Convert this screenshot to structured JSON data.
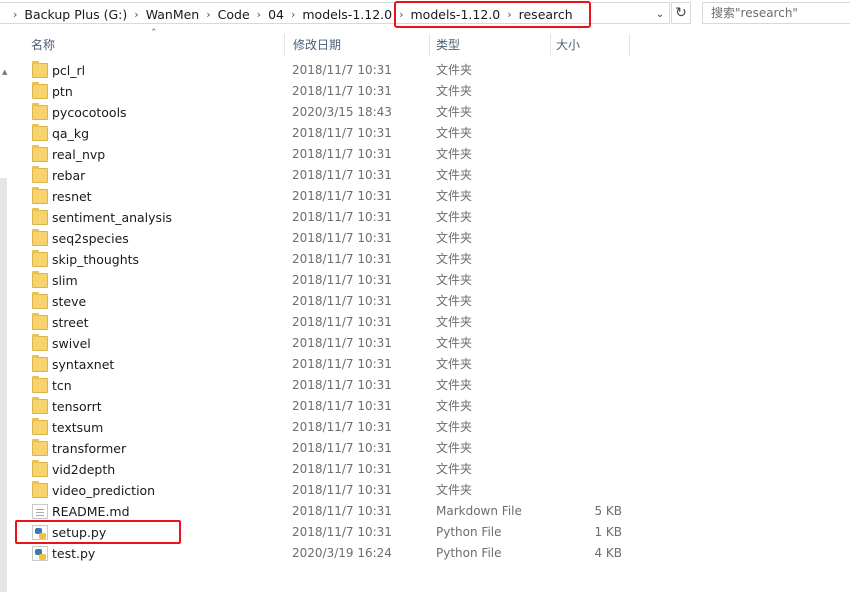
{
  "address": {
    "crumbs": [
      "Backup Plus (G:)",
      "WanMen",
      "Code",
      "04",
      "models-1.12.0"
    ],
    "highlighted_crumbs": [
      "models-1.12.0",
      "research"
    ],
    "search_placeholder": "搜索\"research\""
  },
  "columns": {
    "name": "名称",
    "date": "修改日期",
    "type": "类型",
    "size": "大小"
  },
  "files": [
    {
      "name": "pcl_rl",
      "date": "2018/11/7 10:31",
      "type": "文件夹",
      "size": "",
      "icon": "folder-icon"
    },
    {
      "name": "ptn",
      "date": "2018/11/7 10:31",
      "type": "文件夹",
      "size": "",
      "icon": "folder-icon"
    },
    {
      "name": "pycocotools",
      "date": "2020/3/15 18:43",
      "type": "文件夹",
      "size": "",
      "icon": "folder-icon"
    },
    {
      "name": "qa_kg",
      "date": "2018/11/7 10:31",
      "type": "文件夹",
      "size": "",
      "icon": "folder-icon"
    },
    {
      "name": "real_nvp",
      "date": "2018/11/7 10:31",
      "type": "文件夹",
      "size": "",
      "icon": "folder-icon"
    },
    {
      "name": "rebar",
      "date": "2018/11/7 10:31",
      "type": "文件夹",
      "size": "",
      "icon": "folder-icon"
    },
    {
      "name": "resnet",
      "date": "2018/11/7 10:31",
      "type": "文件夹",
      "size": "",
      "icon": "folder-icon"
    },
    {
      "name": "sentiment_analysis",
      "date": "2018/11/7 10:31",
      "type": "文件夹",
      "size": "",
      "icon": "folder-icon"
    },
    {
      "name": "seq2species",
      "date": "2018/11/7 10:31",
      "type": "文件夹",
      "size": "",
      "icon": "folder-icon"
    },
    {
      "name": "skip_thoughts",
      "date": "2018/11/7 10:31",
      "type": "文件夹",
      "size": "",
      "icon": "folder-icon"
    },
    {
      "name": "slim",
      "date": "2018/11/7 10:31",
      "type": "文件夹",
      "size": "",
      "icon": "folder-icon"
    },
    {
      "name": "steve",
      "date": "2018/11/7 10:31",
      "type": "文件夹",
      "size": "",
      "icon": "folder-icon"
    },
    {
      "name": "street",
      "date": "2018/11/7 10:31",
      "type": "文件夹",
      "size": "",
      "icon": "folder-icon"
    },
    {
      "name": "swivel",
      "date": "2018/11/7 10:31",
      "type": "文件夹",
      "size": "",
      "icon": "folder-icon"
    },
    {
      "name": "syntaxnet",
      "date": "2018/11/7 10:31",
      "type": "文件夹",
      "size": "",
      "icon": "folder-icon"
    },
    {
      "name": "tcn",
      "date": "2018/11/7 10:31",
      "type": "文件夹",
      "size": "",
      "icon": "folder-icon"
    },
    {
      "name": "tensorrt",
      "date": "2018/11/7 10:31",
      "type": "文件夹",
      "size": "",
      "icon": "folder-icon"
    },
    {
      "name": "textsum",
      "date": "2018/11/7 10:31",
      "type": "文件夹",
      "size": "",
      "icon": "folder-icon"
    },
    {
      "name": "transformer",
      "date": "2018/11/7 10:31",
      "type": "文件夹",
      "size": "",
      "icon": "folder-icon"
    },
    {
      "name": "vid2depth",
      "date": "2018/11/7 10:31",
      "type": "文件夹",
      "size": "",
      "icon": "folder-icon"
    },
    {
      "name": "video_prediction",
      "date": "2018/11/7 10:31",
      "type": "文件夹",
      "size": "",
      "icon": "folder-icon"
    },
    {
      "name": "README.md",
      "date": "2018/11/7 10:31",
      "type": "Markdown File",
      "size": "5 KB",
      "icon": "markdown-file-icon"
    },
    {
      "name": "setup.py",
      "date": "2018/11/7 10:31",
      "type": "Python File",
      "size": "1 KB",
      "icon": "python-file-icon"
    },
    {
      "name": "test.py",
      "date": "2020/3/19 16:24",
      "type": "Python File",
      "size": "4 KB",
      "icon": "python-file-icon"
    }
  ],
  "annotation_color": "#e8141c"
}
